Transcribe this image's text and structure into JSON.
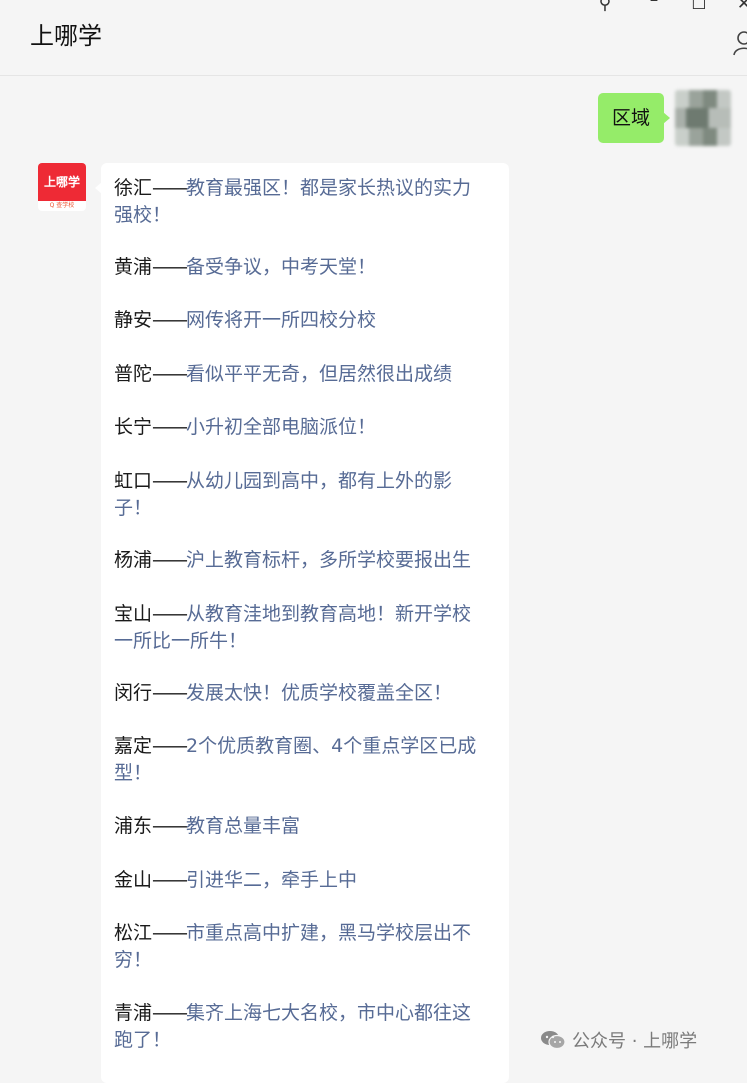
{
  "window": {
    "title": "上哪学"
  },
  "outgoing": {
    "text": "区域"
  },
  "contact": {
    "avatar_top": "上哪学",
    "avatar_bottom": "Q 查学校"
  },
  "separator": "——",
  "districts": [
    {
      "name": "徐汇",
      "lines": [
        "教育最强区！都是家长热议的实力",
        "强校！"
      ]
    },
    {
      "name": "黄浦",
      "lines": [
        "备受争议，中考天堂！"
      ]
    },
    {
      "name": "静安",
      "lines": [
        "网传将开一所四校分校"
      ]
    },
    {
      "name": "普陀",
      "lines": [
        "看似平平无奇，但居然很出成绩"
      ]
    },
    {
      "name": "长宁",
      "lines": [
        "小升初全部电脑派位！"
      ]
    },
    {
      "name": "虹口",
      "lines": [
        "从幼儿园到高中，都有上外的影",
        "子！"
      ]
    },
    {
      "name": "杨浦",
      "lines": [
        "沪上教育标杆，多所学校要报出生"
      ]
    },
    {
      "name": "宝山",
      "lines": [
        "从教育洼地到教育高地！新开学校",
        "一所比一所牛！"
      ]
    },
    {
      "name": "闵行",
      "lines": [
        "发展太快！优质学校覆盖全区！"
      ]
    },
    {
      "name": "嘉定",
      "lines": [
        "2个优质教育圈、4个重点学区已成",
        "型！"
      ]
    },
    {
      "name": "浦东",
      "lines": [
        "教育总量丰富"
      ]
    },
    {
      "name": "金山",
      "lines": [
        "引进华二，牵手上中"
      ]
    },
    {
      "name": "松江",
      "lines": [
        "市重点高中扩建，黑马学校层出不",
        "穷！"
      ]
    },
    {
      "name": "青浦",
      "lines": [
        "集齐上海七大名校，市中心都往这",
        "跑了！"
      ]
    }
  ],
  "watermark": "公众号 · 上哪学"
}
